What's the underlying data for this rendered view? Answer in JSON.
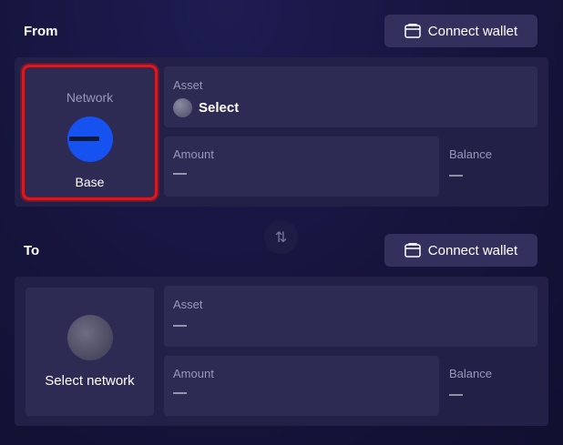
{
  "from": {
    "title": "From",
    "connect_label": "Connect wallet",
    "network_label": "Network",
    "network_name": "Base",
    "asset_label": "Asset",
    "asset_value": "Select",
    "amount_label": "Amount",
    "amount_value": "—",
    "balance_label": "Balance",
    "balance_value": "—"
  },
  "swap": {
    "icon": "swap-vertical-arrows-icon",
    "glyph": "⇅"
  },
  "to": {
    "title": "To",
    "connect_label": "Connect wallet",
    "network_value": "Select network",
    "asset_label": "Asset",
    "asset_value": "—",
    "amount_label": "Amount",
    "amount_value": "—",
    "balance_label": "Balance",
    "balance_value": "—"
  },
  "colors": {
    "background": "#15143c",
    "panel": "#222046",
    "card": "#2d2a54",
    "button": "#34305e",
    "base_blue": "#1652f0",
    "highlight_red": "#e0161b",
    "muted_text": "#9a98b8"
  }
}
